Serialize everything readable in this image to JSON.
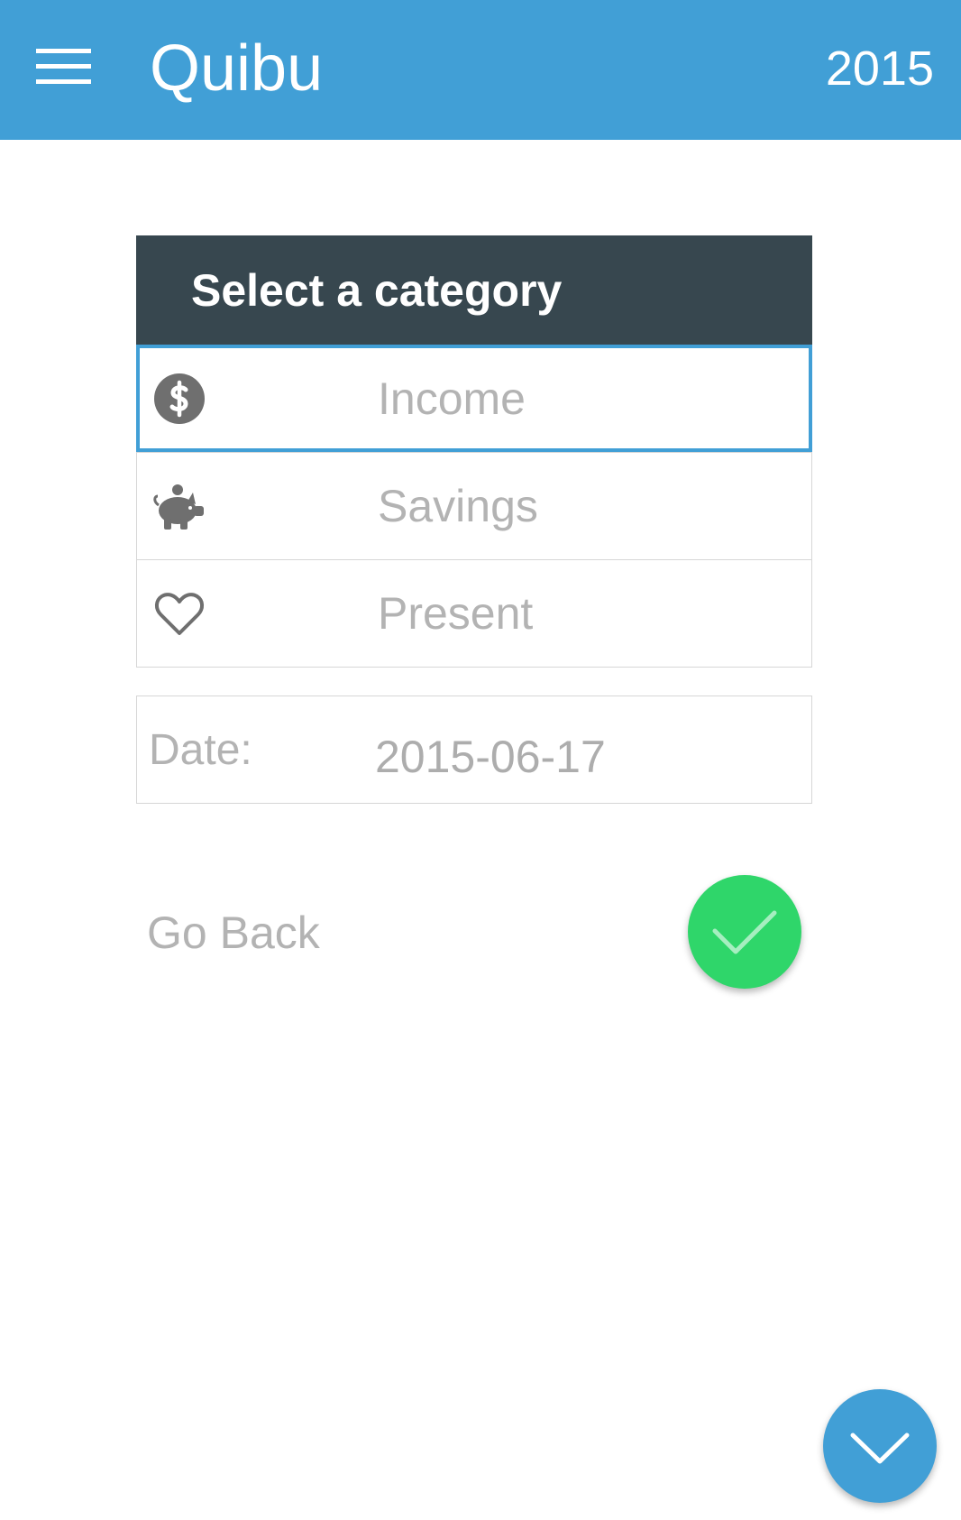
{
  "app": {
    "title": "Quibu",
    "year": "2015",
    "accent_color": "#419fd6",
    "menu_icon": "hamburger-menu-icon"
  },
  "category_card": {
    "title": "Select a category",
    "header_color": "#37474f",
    "selected": "Income",
    "items": [
      {
        "label": "Income",
        "icon": "dollar-coin-icon"
      },
      {
        "label": "Savings",
        "icon": "piggy-bank-icon"
      },
      {
        "label": "Present",
        "icon": "heart-icon"
      }
    ]
  },
  "date_field": {
    "label": "Date:",
    "value": "2015-06-17"
  },
  "actions": {
    "go_back_label": "Go Back",
    "confirm_icon": "checkmark-icon",
    "confirm_color": "#2fd66a",
    "fab_icon": "chevron-down-icon"
  }
}
